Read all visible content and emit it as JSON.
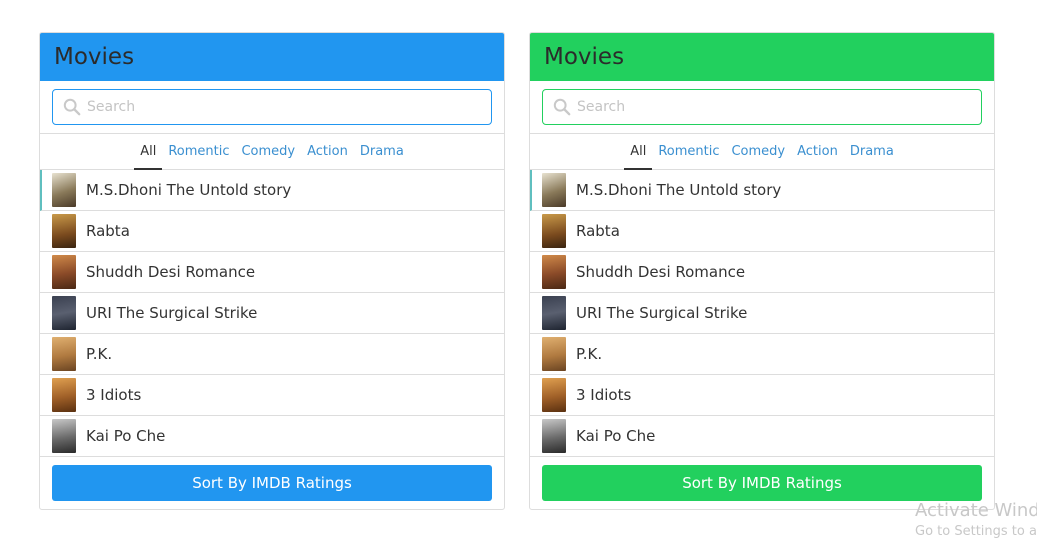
{
  "colors": {
    "panel1_accent": "#2196f0",
    "panel2_accent": "#22d05e",
    "link": "#3a8fd0"
  },
  "panels": [
    {
      "title": "Movies",
      "search_placeholder": "Search",
      "tabs": [
        "All",
        "Romentic",
        "Comedy",
        "Action",
        "Drama"
      ],
      "active_tab": "All",
      "movies": [
        "M.S.Dhoni The Untold story",
        "Rabta",
        "Shuddh Desi Romance",
        "URI The Surgical Strike",
        "P.K.",
        "3 Idiots",
        "Kai Po Che"
      ],
      "sort_label": "Sort By IMDB Ratings"
    },
    {
      "title": "Movies",
      "search_placeholder": "Search",
      "tabs": [
        "All",
        "Romentic",
        "Comedy",
        "Action",
        "Drama"
      ],
      "active_tab": "All",
      "movies": [
        "M.S.Dhoni The Untold story",
        "Rabta",
        "Shuddh Desi Romance",
        "URI The Surgical Strike",
        "P.K.",
        "3 Idiots",
        "Kai Po Che"
      ],
      "sort_label": "Sort By IMDB Ratings"
    }
  ],
  "watermark": {
    "title": "Activate Wind",
    "subtitle": "Go to Settings to a"
  }
}
